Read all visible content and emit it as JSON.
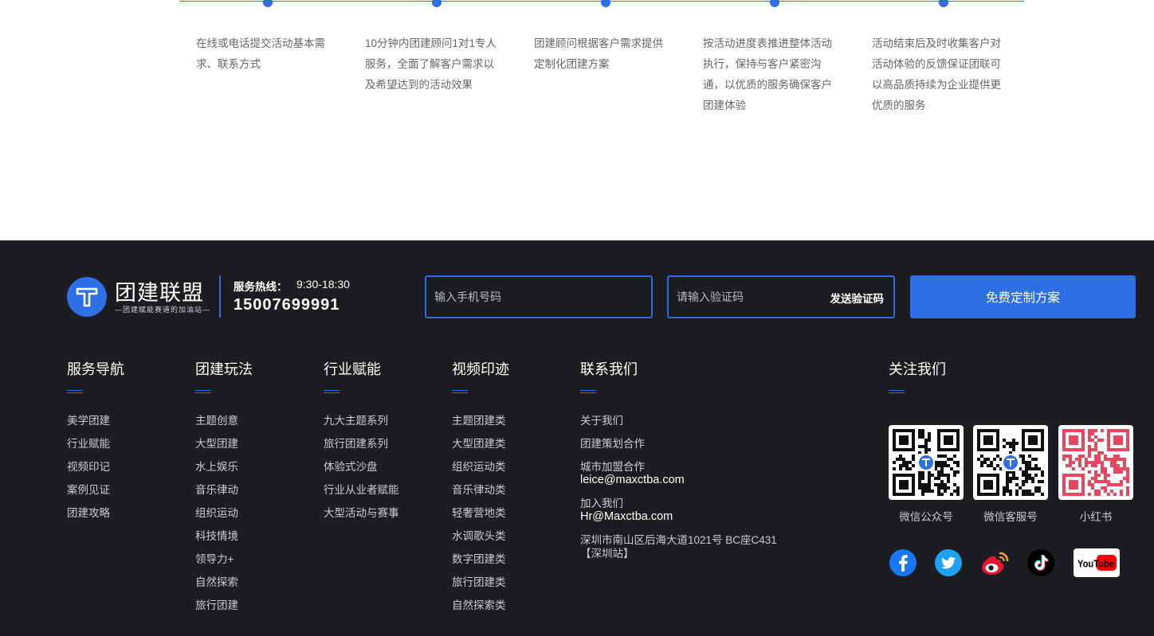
{
  "process": {
    "steps": [
      {
        "text": "在线或电话提交活动基本需求、联系方式"
      },
      {
        "text": "10分钟内团建顾问1对1专人服务，全面了解客户需求以及希望达到的活动效果"
      },
      {
        "text": "团建顾问根据客户需求提供定制化团建方案"
      },
      {
        "text": "按活动进度表推进整体活动执行，保持与客户紧密沟通，以优质的服务确保客户团建体验"
      },
      {
        "text": "活动结束后及时收集客户对活动体验的反馈保证团联可以高品质持续为企业提供更优质的服务"
      }
    ]
  },
  "footer": {
    "logo": {
      "name": "团建联盟",
      "slogan": "—团建赋能赛道的加油站—"
    },
    "hotline": {
      "label": "服务热线：",
      "hours": "9:30-18:30",
      "phone": "15007699991"
    },
    "form": {
      "phone_placeholder": "输入手机号码",
      "code_placeholder": "请输入验证码",
      "send_code_label": "发送验证码",
      "submit_label": "免费定制方案"
    },
    "columns": [
      {
        "title": "服务导航",
        "items": [
          "美学团建",
          "行业赋能",
          "视频印记",
          "案例见证",
          "团建攻略"
        ]
      },
      {
        "title": "团建玩法",
        "items": [
          "主题创意",
          "大型团建",
          "水上娱乐",
          "音乐律动",
          "组织运动",
          "科技情境",
          "领导力+",
          "自然探索",
          "旅行团建"
        ]
      },
      {
        "title": "行业赋能",
        "items": [
          "九大主题系列",
          "旅行团建系列",
          "体验式沙盘",
          "行业从业者赋能",
          "大型活动与赛事"
        ]
      },
      {
        "title": "视频印迹",
        "items": [
          "主题团建类",
          "大型团建类",
          "组织运动类",
          "音乐律动类",
          "轻奢营地类",
          "水调歌头类",
          "数字团建类",
          "旅行团建类",
          "自然探索类"
        ]
      }
    ],
    "contact": {
      "title": "联系我们",
      "about": "关于我们",
      "planning": "团建策划合作",
      "franchise_label": "城市加盟合作",
      "franchise_email": "leice@maxctba.com",
      "join_label": "加入我们",
      "join_email": "Hr@Maxctba.com",
      "address": "深圳市南山区后海大道1021号 BC座C431",
      "station": "【深圳站】"
    },
    "follow": {
      "title": "关注我们",
      "qr_codes": [
        {
          "label": "微信公众号"
        },
        {
          "label": "微信客服号"
        },
        {
          "label": "小红书"
        }
      ],
      "social": [
        {
          "icon": "facebook-icon",
          "color": "#1877f2"
        },
        {
          "icon": "twitter-icon",
          "color": "#1da1f2"
        },
        {
          "icon": "weibo-icon",
          "color": "#e6162d"
        },
        {
          "icon": "tiktok-icon",
          "color": "#000000"
        },
        {
          "icon": "youtube-icon",
          "color": "#ff0000",
          "label": "YouTube"
        }
      ]
    }
  },
  "colors": {
    "accent": "#2f6fe6",
    "footer_bg": "#1c1d20"
  }
}
